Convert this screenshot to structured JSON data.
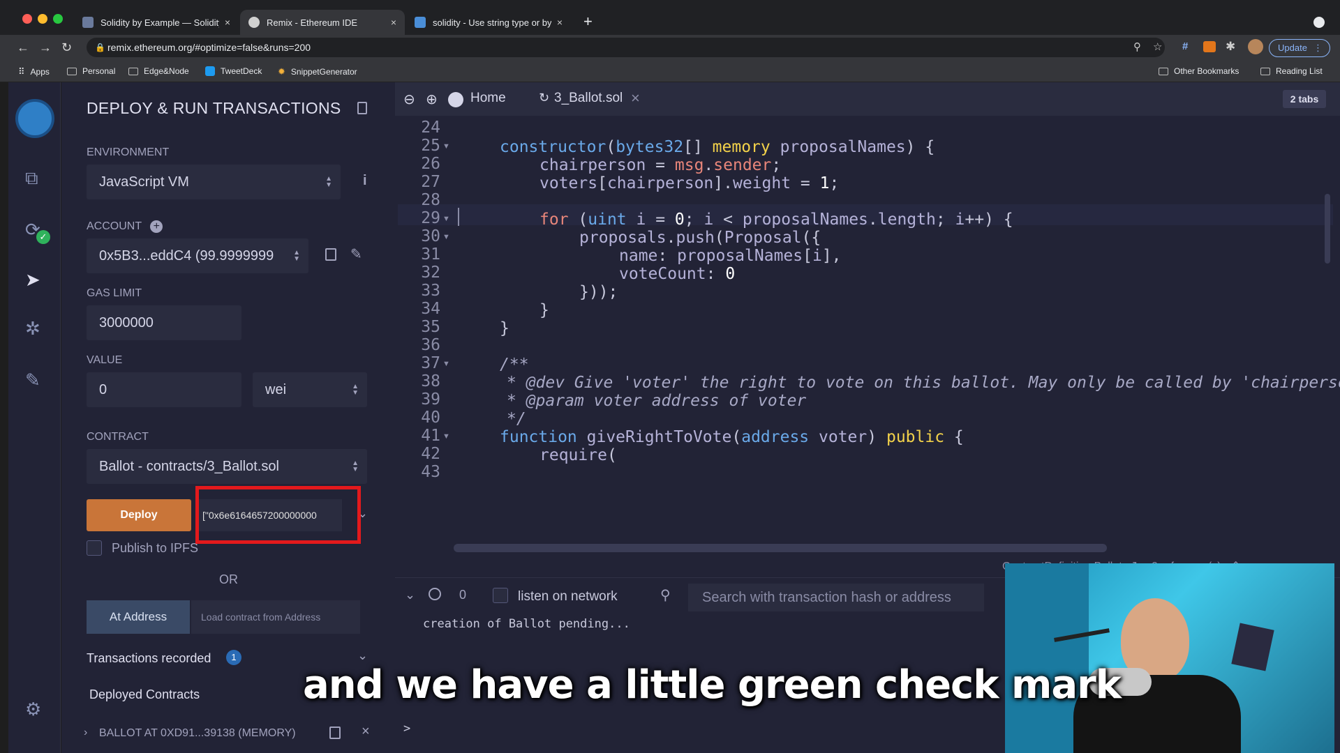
{
  "browser": {
    "tabs": [
      {
        "title": "Solidity by Example — Solidity",
        "close": "×",
        "color": "#6a7a9c"
      },
      {
        "title": "Remix - Ethereum IDE",
        "close": "×",
        "color": "#d0d0d0"
      },
      {
        "title": "solidity - Use string type or by",
        "close": "×",
        "color": "#4a8ed8"
      }
    ],
    "new_tab": "+",
    "url": "remix.ethereum.org/#optimize=false&runs=200",
    "update_label": "Update",
    "bookmarks": [
      "Apps",
      "Personal",
      "Edge&Node",
      "TweetDeck",
      "SnippetGenerator"
    ],
    "bookmarks_right": [
      "Other Bookmarks",
      "Reading List"
    ]
  },
  "sidepanel": {
    "title": "DEPLOY & RUN TRANSACTIONS",
    "environment_label": "ENVIRONMENT",
    "environment_value": "JavaScript VM",
    "account_label": "ACCOUNT",
    "account_value": "0x5B3...eddC4 (99.9999999",
    "gas_limit_label": "GAS LIMIT",
    "gas_limit_value": "3000000",
    "value_label": "VALUE",
    "value_amount": "0",
    "value_unit": "wei",
    "contract_label": "CONTRACT",
    "contract_value": "Ballot - contracts/3_Ballot.sol",
    "deploy_label": "Deploy",
    "deploy_args": "[\"0x6e6164657200000000",
    "publish_label": "Publish to IPFS",
    "or_label": "OR",
    "at_address_label": "At Address",
    "load_address_placeholder": "Load contract from Address",
    "tx_recorded_label": "Transactions recorded",
    "tx_recorded_count": "1",
    "deployed_contracts_label": "Deployed Contracts",
    "deployed_instance": "BALLOT AT 0XD91...39138 (MEMORY)"
  },
  "editor": {
    "home_tab": "Home",
    "file_tab": "3_Ballot.sol",
    "tabs_count": "2 tabs",
    "line_numbers": [
      "24",
      "25",
      "26",
      "27",
      "28",
      "29",
      "30",
      "31",
      "32",
      "33",
      "34",
      "35",
      "36",
      "37",
      "38",
      "39",
      "40",
      "41",
      "42",
      "43"
    ],
    "contract_definition": "ContractDefinition Ballot",
    "references": "0 reference(s)"
  },
  "terminal": {
    "count": "0",
    "listen_label": "listen on network",
    "search_placeholder": "Search with transaction hash or address",
    "log_line": "creation of Ballot pending...",
    "prompt": ">"
  },
  "subtitle": "and we have a little green check mark",
  "colors": {
    "accent_deploy": "#c97539",
    "highlight_box": "#e3191c",
    "panel_bg": "#222336",
    "keyword": "#6aa9e9",
    "type_yellow": "#f3d24a"
  }
}
